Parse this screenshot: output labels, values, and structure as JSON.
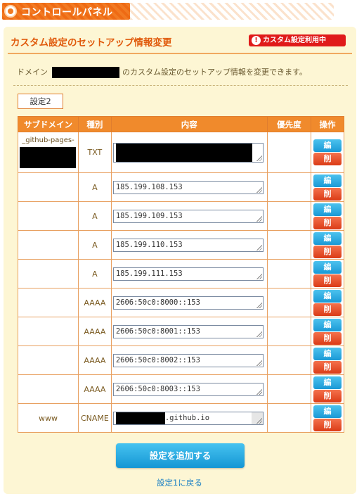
{
  "header": {
    "title": "コントロールパネル",
    "gear_icon": "gear-icon"
  },
  "panel": {
    "title": "カスタム設定のセットアップ情報変更",
    "badge": "カスタム設定利用中",
    "badge_icon": "!",
    "description_prefix": "ドメイン",
    "description_suffix": "のカスタム設定のセットアップ情報を変更できます。",
    "set_label": "設定2"
  },
  "table": {
    "headers": {
      "subdomain": "サブドメイン",
      "type": "種別",
      "content": "内容",
      "priority": "優先度",
      "operation": "操作"
    },
    "edit_label": "編",
    "delete_label": "削",
    "rows": [
      {
        "subdomain": "_github-pages-",
        "type": "TXT",
        "content": ""
      },
      {
        "subdomain": "",
        "type": "A",
        "content": "185.199.108.153"
      },
      {
        "subdomain": "",
        "type": "A",
        "content": "185.199.109.153"
      },
      {
        "subdomain": "",
        "type": "A",
        "content": "185.199.110.153"
      },
      {
        "subdomain": "",
        "type": "A",
        "content": "185.199.111.153"
      },
      {
        "subdomain": "",
        "type": "AAAA",
        "content": "2606:50c0:8000::153"
      },
      {
        "subdomain": "",
        "type": "AAAA",
        "content": "2606:50c0:8001::153"
      },
      {
        "subdomain": "",
        "type": "AAAA",
        "content": "2606:50c0:8002::153"
      },
      {
        "subdomain": "",
        "type": "AAAA",
        "content": "2606:50c0:8003::153"
      },
      {
        "subdomain": "www",
        "type": "CNAME",
        "content": ".github.io"
      }
    ]
  },
  "actions": {
    "add_button": "設定を追加する",
    "back_link": "設定1に戻る"
  },
  "colors": {
    "accent": "#f08a2c",
    "panel_bg": "#fdf6d4",
    "edit_button": "#1a99d6",
    "delete_button": "#db3b16",
    "badge": "#e01a1a"
  }
}
